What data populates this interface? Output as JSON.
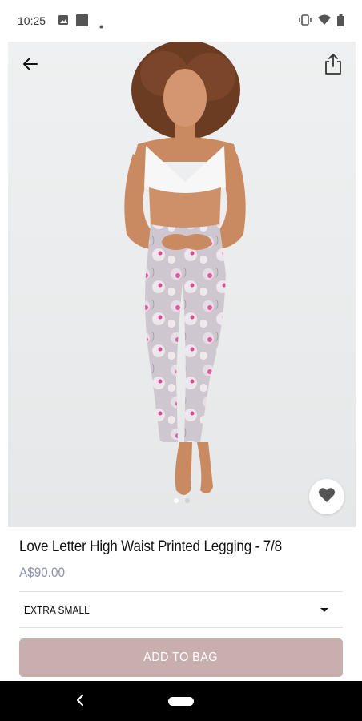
{
  "status_bar": {
    "time": "10:25",
    "icons": [
      "image-icon",
      "square-icon",
      "dot-icon",
      "vibrate-icon",
      "wifi-icon",
      "battery-icon"
    ]
  },
  "hero": {
    "icons": {
      "back": "arrow-left-icon",
      "share": "share-icon",
      "wishlist": "heart-icon"
    },
    "carousel": {
      "total": 2,
      "active_index": 0
    }
  },
  "product": {
    "name": "Love Letter High Waist Printed Legging - 7/8",
    "price": "A$90.00"
  },
  "size_select": {
    "selected": "EXTRA SMALL"
  },
  "add_to_bag": {
    "label": "ADD TO BAG"
  },
  "colors": {
    "price": "#8e92b0",
    "button": "#c9aeae",
    "nav_bar": "#000000"
  },
  "nav": {
    "icons": [
      "chevron-left-icon",
      "home-pill-icon"
    ]
  }
}
